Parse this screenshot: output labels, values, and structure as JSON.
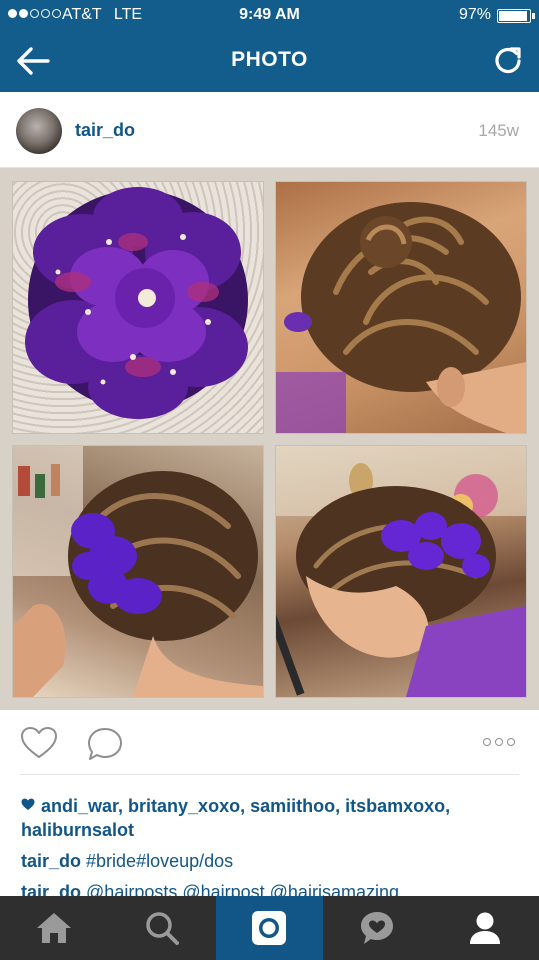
{
  "status_bar": {
    "carrier": "AT&T",
    "network": "LTE",
    "time": "9:49 AM",
    "battery": "97%",
    "battery_level": 0.97,
    "signal_bars_filled": 2,
    "signal_bars_total": 5
  },
  "nav": {
    "title": "PHOTO",
    "back_icon": "arrow-left-icon",
    "refresh_icon": "refresh-icon"
  },
  "post": {
    "username": "tair_do",
    "age": "145w",
    "photo_tiles": [
      "purple-flower-hairpiece",
      "updo-back-view",
      "updo-with-purple-flowers-side",
      "updo-with-purple-flowers-front"
    ]
  },
  "actions": {
    "like_icon": "heart-outline-icon",
    "comment_icon": "speech-bubble-icon",
    "more_icon": "ellipsis-icon"
  },
  "likes": {
    "users": [
      "andi_war",
      "britany_xoxo",
      "samiithoo",
      "itsbamxoxo",
      "haliburnsalot"
    ],
    "text": "andi_war, britany_xoxo, samiithoo, itsbamxoxo, haliburnsalot"
  },
  "captions": [
    {
      "user": "tair_do",
      "text": "#bride#loveup/dos"
    },
    {
      "user": "tair_do",
      "text": "@hairposts @hairpost @hairisamazing"
    }
  ],
  "tabbar": {
    "items": [
      "home-icon",
      "search-icon",
      "camera-icon",
      "activity-icon",
      "profile-icon"
    ],
    "active": "camera-icon"
  },
  "colors": {
    "header": "#135d8d",
    "link": "#125688",
    "tabbar": "#2f2f2f",
    "tab_active": "#125688"
  }
}
